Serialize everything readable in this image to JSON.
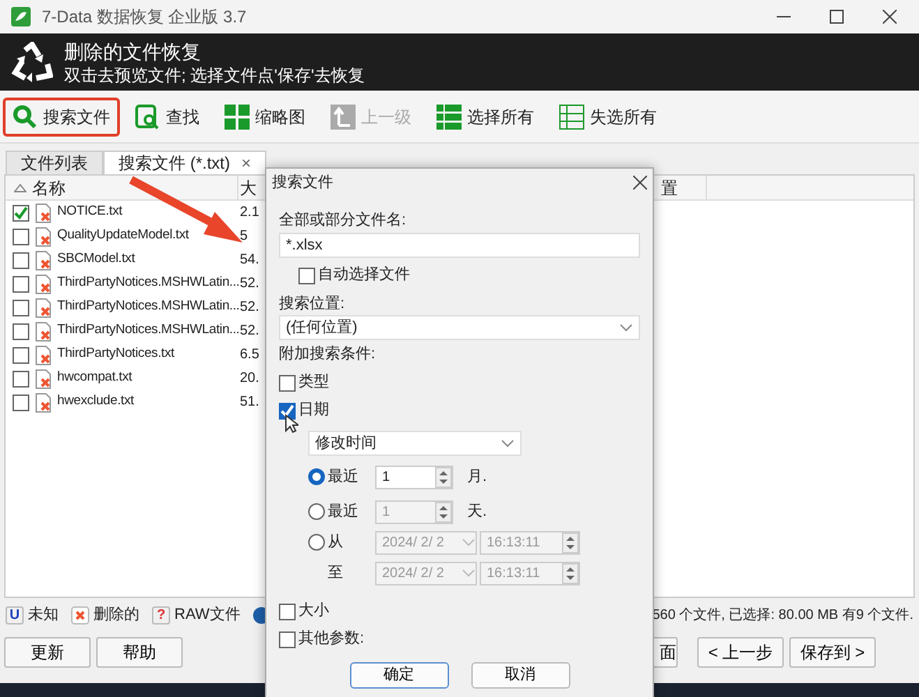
{
  "window": {
    "title": "7-Data 数据恢复 企业版 3.7"
  },
  "header": {
    "title": "删除的文件恢复",
    "subtitle": "双击去预览文件; 选择文件点'保存'去恢复"
  },
  "toolbar": [
    {
      "label": "搜索文件",
      "kind": "search",
      "highlighted": true,
      "disabled": false
    },
    {
      "label": "查找",
      "kind": "find",
      "highlighted": false,
      "disabled": false
    },
    {
      "label": "缩略图",
      "kind": "grid",
      "highlighted": false,
      "disabled": false
    },
    {
      "label": "上一级",
      "kind": "up",
      "highlighted": false,
      "disabled": true
    },
    {
      "label": "选择所有",
      "kind": "list",
      "highlighted": false,
      "disabled": false
    },
    {
      "label": "失选所有",
      "kind": "outline",
      "highlighted": false,
      "disabled": false
    }
  ],
  "tabs": [
    {
      "label": "文件列表",
      "selected": false
    },
    {
      "label": "搜索文件 (*.txt)",
      "selected": true,
      "close": "×"
    }
  ],
  "file_list": {
    "columns": [
      "名称",
      "大",
      "置"
    ],
    "rows": [
      {
        "name": "NOTICE.txt",
        "size": "2.1",
        "checked": true
      },
      {
        "name": "QualityUpdateModel.txt",
        "size": "5",
        "checked": false
      },
      {
        "name": "SBCModel.txt",
        "size": "54.",
        "checked": false
      },
      {
        "name": "ThirdPartyNotices.MSHWLatin...",
        "size": "52.",
        "checked": false
      },
      {
        "name": "ThirdPartyNotices.MSHWLatin...",
        "size": "52.",
        "checked": false
      },
      {
        "name": "ThirdPartyNotices.MSHWLatin...",
        "size": "52.",
        "checked": false
      },
      {
        "name": "ThirdPartyNotices.txt",
        "size": "6.5",
        "checked": false
      },
      {
        "name": "hwcompat.txt",
        "size": "20.",
        "checked": false
      },
      {
        "name": "hwexclude.txt",
        "size": "51.",
        "checked": false
      }
    ]
  },
  "legend": [
    {
      "kind": "unknown",
      "badge": "U",
      "label": "未知"
    },
    {
      "kind": "deleted",
      "label": "删除的"
    },
    {
      "kind": "raw",
      "badge": "?",
      "label": "RAW文件"
    },
    {
      "kind": "disk"
    }
  ],
  "status": "560 个文件, 已选择: 80.00 MB 有9 个文件.",
  "left_buttons": [
    "更新",
    "帮助"
  ],
  "right_buttons": [
    "面",
    "< 上一步",
    "保存到 >"
  ],
  "dialog": {
    "title": "搜索文件",
    "filename_label": "全部或部分文件名:",
    "filename_value": "*.xlsx",
    "auto_select": {
      "label": "自动选择文件",
      "checked": false
    },
    "location_label": "搜索位置:",
    "location_value": "(任何位置)",
    "conditions_label": "附加搜索条件:",
    "type": {
      "label": "类型",
      "checked": false
    },
    "date": {
      "label": "日期",
      "checked": true
    },
    "date_field": "修改时间",
    "date_options": [
      {
        "kind": "recent",
        "label": "最近",
        "selected": true,
        "value": "1",
        "unit": "月."
      },
      {
        "kind": "recent",
        "label": "最近",
        "selected": false,
        "value": "1",
        "unit": "天."
      },
      {
        "kind": "range",
        "label": "从",
        "selected": false,
        "date": "2024/ 2/ 2",
        "time": "16:13:11"
      }
    ],
    "to_label": "至",
    "to_date": "2024/ 2/ 2",
    "to_time": "16:13:11",
    "size": {
      "label": "大小",
      "checked": false
    },
    "other": {
      "label": "其他参数:",
      "checked": false
    },
    "buttons": [
      "确定",
      "取消"
    ]
  }
}
